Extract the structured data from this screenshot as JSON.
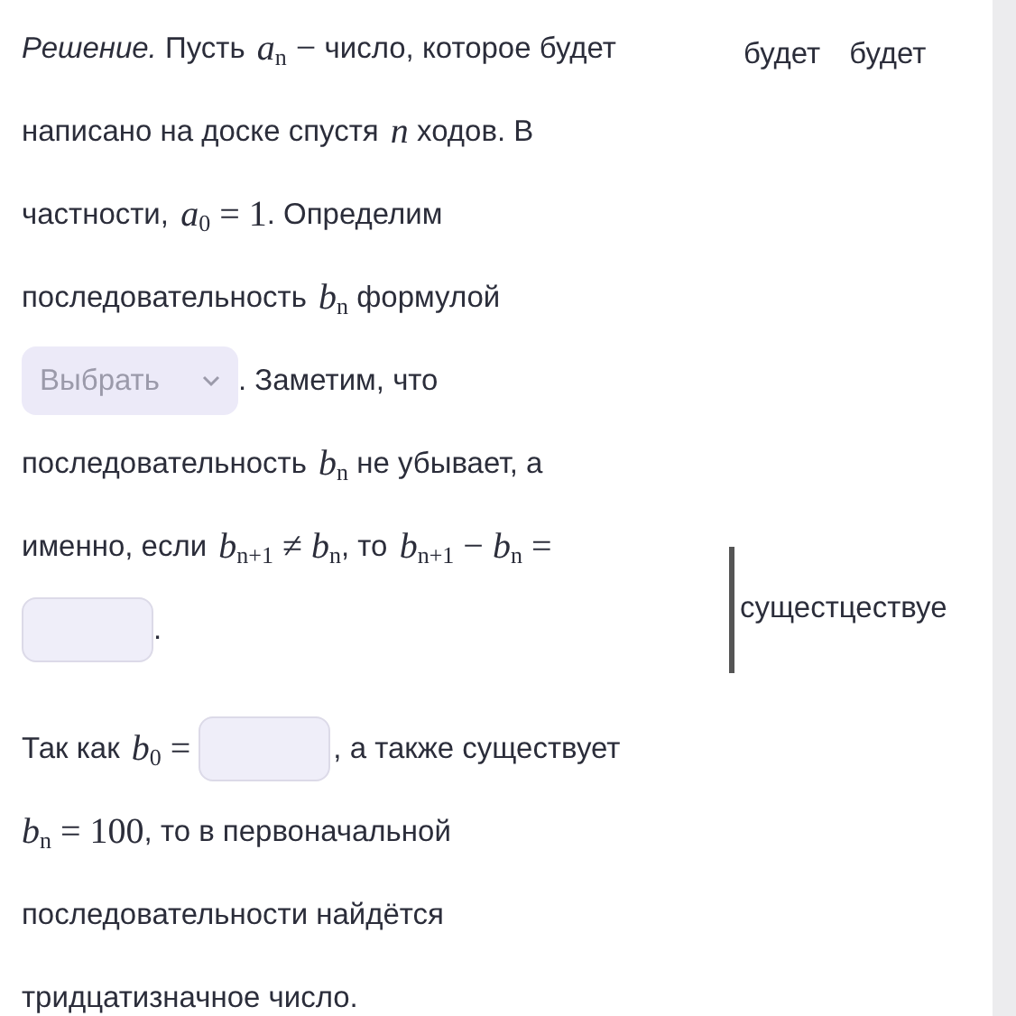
{
  "paragraphs": [
    {
      "lines": [
        [
          {
            "kind": "text",
            "text": "*Решение.* Пусть "
          },
          {
            "kind": "math",
            "text": "*a*$_{n}$ −"
          },
          {
            "kind": "text",
            "text": " число, которое будет"
          }
        ],
        [
          {
            "kind": "text",
            "text": "написано на доске спустя "
          },
          {
            "kind": "math",
            "text": "*n*"
          },
          {
            "kind": "text",
            "text": " ходов. В"
          }
        ],
        [
          {
            "kind": "text",
            "text": "частности, "
          },
          {
            "kind": "math",
            "text": "*a*$_{0}$ = 1"
          },
          {
            "kind": "text",
            "text": ". Определим"
          }
        ],
        [
          {
            "kind": "text",
            "text": "последовательность "
          },
          {
            "kind": "math",
            "text": "*b*$_{n}$"
          },
          {
            "kind": "text",
            "text": " формулой"
          }
        ],
        [
          {
            "kind": "select",
            "placeholder": "Выбрать"
          },
          {
            "kind": "text",
            "text": ". Заметим, что"
          }
        ],
        [
          {
            "kind": "text",
            "text": "последовательность "
          },
          {
            "kind": "math",
            "text": "*b*$_{n}$"
          },
          {
            "kind": "text",
            "text": " не убывает, а"
          }
        ],
        [
          {
            "kind": "text",
            "text": "именно, если "
          },
          {
            "kind": "math",
            "text": "*b*$_{n+1}$ ≠ *b*$_{n}$"
          },
          {
            "kind": "text",
            "text": ", то "
          },
          {
            "kind": "math",
            "text": "*b*$_{n+1}$ − *b*$_{n}$ ="
          }
        ],
        [
          {
            "kind": "input"
          },
          {
            "kind": "text",
            "text": "."
          }
        ]
      ]
    },
    {
      "lines": [
        [
          {
            "kind": "text",
            "text": "Так как "
          },
          {
            "kind": "math",
            "text": "*b*$_{0}$ ="
          },
          {
            "kind": "input"
          },
          {
            "kind": "text",
            "text": ", а также существует"
          }
        ],
        [
          {
            "kind": "math",
            "text": "*b*$_{n}$ = 100"
          },
          {
            "kind": "text",
            "text": ", то в первоначальной"
          }
        ],
        [
          {
            "kind": "text",
            "text": "последовательности найдётся"
          }
        ],
        [
          {
            "kind": "text",
            "text": "тридцатизначное число."
          }
        ]
      ]
    }
  ],
  "side_fragments": [
    {
      "text": "будет"
    },
    {
      "text": "будет"
    },
    {
      "text": "сущестцествуе",
      "cursor": true
    }
  ]
}
